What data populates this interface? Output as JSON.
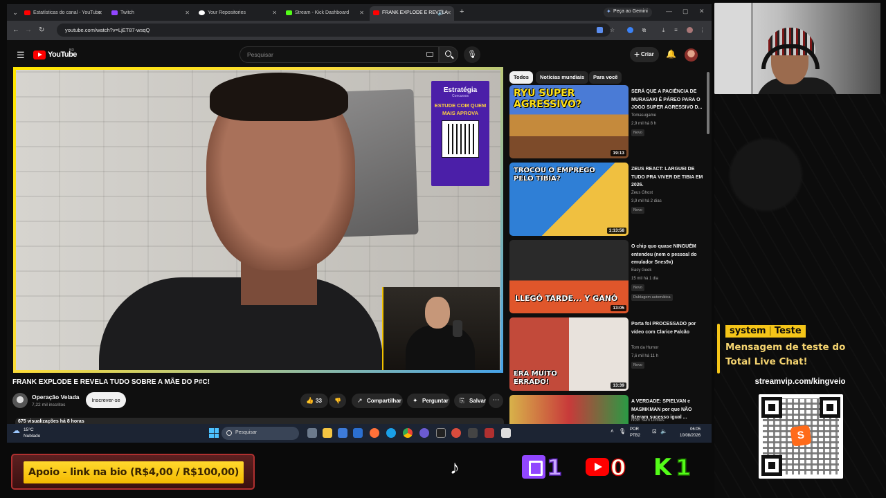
{
  "browser": {
    "tabs": [
      {
        "title": "Estatísticas do canal - YouTube",
        "color": "#ff0000"
      },
      {
        "title": "Twitch",
        "color": "#9146ff"
      },
      {
        "title": "Your Repositories",
        "color": "#ffffff"
      },
      {
        "title": "Stream - Kick Dashboard",
        "color": "#53fc18"
      },
      {
        "title": "FRANK EXPLODE E REVELA",
        "color": "#ff0000"
      }
    ],
    "gemini_label": "Peça ao Gemini",
    "url": "youtube.com/watch?v=LjET87-wsqQ"
  },
  "youtube": {
    "logo_text": "YouTube",
    "country_code": "BR",
    "search_placeholder": "Pesquisar",
    "create_label": "Criar",
    "chips": [
      "Todos",
      "Notícias mundiais",
      "Para você"
    ],
    "video": {
      "title": "FRANK EXPLODE E REVELA TUDO SOBRE A MÃE DO P#C!",
      "channel": "Operação Velada",
      "subscribers": "7,22 mil inscritos",
      "subscribe_label": "Inscrever-se",
      "likes": "33",
      "share_label": "Compartilhar",
      "ask_label": "Perguntar",
      "save_label": "Salvar",
      "views": "675 visualizações  há 8 horas",
      "promo": {
        "brand": "Estratégia",
        "brand_sub": "Concursos",
        "cta": "ESTUDE COM QUEM MAIS APROVA"
      }
    },
    "recommendations": [
      {
        "title": "SERÁ QUE A PACIÊNCIA DE MURASAKI É PÁREO PARA O JOGO SUPER AGRESSIVO D...",
        "channel": "Tomasugame",
        "meta": "2,9 mil  há 8 h",
        "badge": "Novo",
        "duration": "19:13",
        "thumb_text": "RYU SUPER AGRESSIVO?",
        "dub": ""
      },
      {
        "title": "ZEUS REACT: LARGUEI DE TUDO PRA VIVER DE TIBIA EM 2026.",
        "channel": "Zeus Ghost",
        "meta": "3,9 mil  há 2 dias",
        "badge": "Novo",
        "duration": "1:13:58",
        "thumb_text": "TROCOU O EMPREGO PELO TIBIA?",
        "dub": ""
      },
      {
        "title": "O chip quo quase NINGUÉM entendeu (nem o pessoal do emulador Snes9x)",
        "channel": "Easy Geek",
        "meta": "15 mil  há 1 dia",
        "badge": "Novo",
        "duration": "13:05",
        "thumb_text": "LLEGÓ TARDE... Y GANÓ",
        "dub": "Dublagem automática"
      },
      {
        "title": "Porta foi PROCESSADO por vídeo com Clarice Falcão",
        "channel": "Tom da Humor",
        "meta": "7,6 mil  há 11 h",
        "badge": "Novo",
        "duration": "13:39",
        "thumb_text": "ERA MUITO ERRADO!",
        "dub": ""
      },
      {
        "title": "A VERDADE: SPIELVAN e MASMKMAN por que NÃO fizeram sucesso igual ...",
        "channel": "NGE Sem Limites",
        "meta": "",
        "badge": "",
        "duration": "",
        "thumb_text": "",
        "dub": ""
      }
    ]
  },
  "taskbar": {
    "weather_temp": "15°C",
    "weather_desc": "Nublado",
    "search_label": "Pesquisar",
    "lang": "POR",
    "layout": "PTB2",
    "time": "06:05",
    "date": "10/08/2026"
  },
  "overlay": {
    "chat_user": "system",
    "chat_tag": "Teste",
    "chat_message": "Mensagem de teste do Total Live Chat!",
    "stream_url": "streamvip.com/kingveio",
    "support_text": "Apoio - link na bio (R$4,00 / R$100,00)",
    "counters": {
      "twitch": "1",
      "youtube": "0",
      "kick": "1"
    },
    "colors": {
      "accent": "#f5c518",
      "twitch": "#9146ff",
      "youtube": "#ff0000",
      "kick": "#53fc18"
    }
  }
}
